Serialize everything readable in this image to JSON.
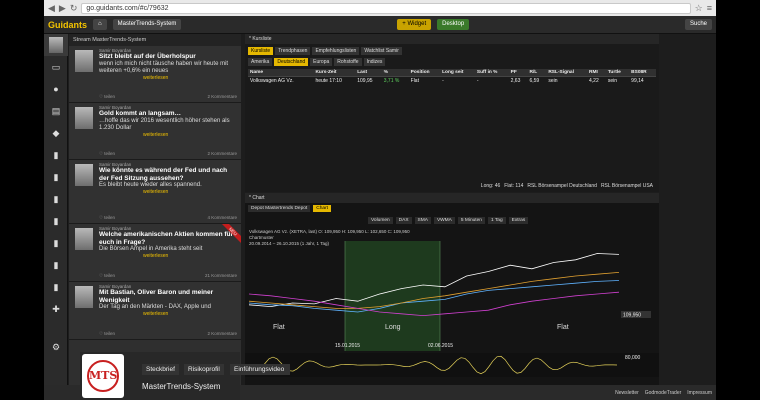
{
  "browser": {
    "url": "go.guidants.com/#c/79632"
  },
  "topbar": {
    "logo": "Guidants",
    "workspace": "MasterTrends-System",
    "btn_a": "+ Widget",
    "btn_b": "Desktop",
    "search": "Suche"
  },
  "stream": {
    "header": "Stream MasterTrends-System",
    "posts": [
      {
        "author": "Samir Boyardan",
        "title": "Sitzt bleibt auf der Überholspur",
        "body": "wenn ich mich nicht täusche haben wir heute mit weiteren +0,6% ein neues",
        "more": "weiterlesen",
        "likes": "2 Kommentare"
      },
      {
        "author": "Samir Boyardan",
        "title": "Gold kommt an langsam…",
        "body": "…hoffe das wir 2016 wesentlich höher stehen als 1.230 Dollar",
        "more": "weiterlesen",
        "likes": "2 Kommentare"
      },
      {
        "author": "Samir Boyardan",
        "title": "Wie könnte es während der Fed und nach der Fed Sitzung aussehen?",
        "body": "Es bleibt heute wieder alles spannend.",
        "more": "weiterlesen",
        "likes": "4 Kommentare"
      },
      {
        "author": "Samir Boyardan",
        "title": "Welche amerikanischen Aktien kommen für euch in Frage?",
        "body": "Die Börsen Ampel in Amerika steht seit",
        "more": "weiterlesen",
        "likes": "21 Kommentare",
        "ribbon": "NEU"
      },
      {
        "author": "Samir Boyardan",
        "title": "Mit Bastian, Oliver Baron und meiner Wenigkeit",
        "body": "Der Tag an den Märkten - DAX, Apple und",
        "more": "weiterlesen",
        "likes": "2 Kommentare"
      }
    ]
  },
  "kurs": {
    "header": "* Kursliste",
    "tabs": [
      "Kursliste",
      "Trendphasen",
      "Empfehlungslisten",
      "Watchlist Samir"
    ],
    "subtabs": [
      "Amerika",
      "Deutschland",
      "Europa",
      "Rohstoffe",
      "Indizes"
    ],
    "columns": [
      "Name",
      "Kurs-Zeit",
      "Last",
      "%",
      "Position",
      "Long seit",
      "Suff in %",
      "PF",
      "R/L",
      "RSL-Signal",
      "RMI",
      "Turtle",
      "BS08R"
    ],
    "rows": [
      [
        "Volkswagen AG Vz.",
        "heute 17:10",
        "109,95",
        "3,71 %",
        "Flat",
        "-",
        "-",
        "2,63",
        "6,59",
        "sein",
        "4,22",
        "sein",
        "99,14"
      ]
    ],
    "footer_long": "Long: 46",
    "footer_flat": "Flat: 114",
    "footer_a": "RSL Börsenampel Deutschland",
    "footer_b": "RSL Börsenampel USA"
  },
  "chart": {
    "header": "* Chart",
    "tabs": [
      "Depot Mastertrends Depot",
      "Chart"
    ],
    "tools": [
      "Volumen",
      "DAX",
      "SMA",
      "VWMA",
      "5 Minuten",
      "1 Tag",
      "Extras"
    ],
    "legend": [
      "Volkswagen AG Vz. (XETRA, last) O: 109,950 H: 109,950 L: 102,650 C: 109,950",
      "Chartmuster",
      "20.09.2014 – 26.10.2015 (1 Jahr, 1 Tag)"
    ],
    "dates": [
      "15.01.2015",
      "02.06.2015"
    ],
    "zones": [
      "Flat",
      "Long",
      "Flat"
    ],
    "price_label": "109,950",
    "osc_label": "80,000"
  },
  "video": {
    "tab1": "Steckbrief",
    "tab2": "Risikoprofil",
    "tab3": "Einführungsvideo",
    "title": "MasterTrends-System",
    "logo": "MTS"
  },
  "status": {
    "items": [
      "Newsletter",
      "GodmodeTrader",
      "Impressum"
    ]
  },
  "colors": {
    "accent": "#e5b800",
    "green": "#2e8b2e"
  },
  "chart_data": {
    "type": "line",
    "series": [
      {
        "name": "Volkswagen AG Vz.",
        "values": [
          0.62,
          0.64,
          0.6,
          0.61,
          0.55,
          0.58,
          0.5,
          0.44,
          0.4,
          0.42,
          0.3,
          0.25,
          0.18,
          0.22,
          0.15,
          0.12,
          0.05,
          0.06
        ]
      },
      {
        "name": "DAX",
        "values": [
          0.6,
          0.62,
          0.63,
          0.66,
          0.68,
          0.7,
          0.66,
          0.6,
          0.58,
          0.56,
          0.5,
          0.46,
          0.44,
          0.42,
          0.4,
          0.38,
          0.36,
          0.35
        ]
      },
      {
        "name": "SMA",
        "values": [
          0.58,
          0.6,
          0.62,
          0.64,
          0.66,
          0.66,
          0.64,
          0.6,
          0.55,
          0.52,
          0.48,
          0.44,
          0.4,
          0.36,
          0.33,
          0.3,
          0.28,
          0.26
        ]
      },
      {
        "name": "VWMA",
        "values": [
          0.5,
          0.52,
          0.55,
          0.58,
          0.62,
          0.66,
          0.7,
          0.72,
          0.74,
          0.72,
          0.7,
          0.68,
          0.62,
          0.58,
          0.55,
          0.52,
          0.5,
          0.48
        ]
      }
    ]
  }
}
